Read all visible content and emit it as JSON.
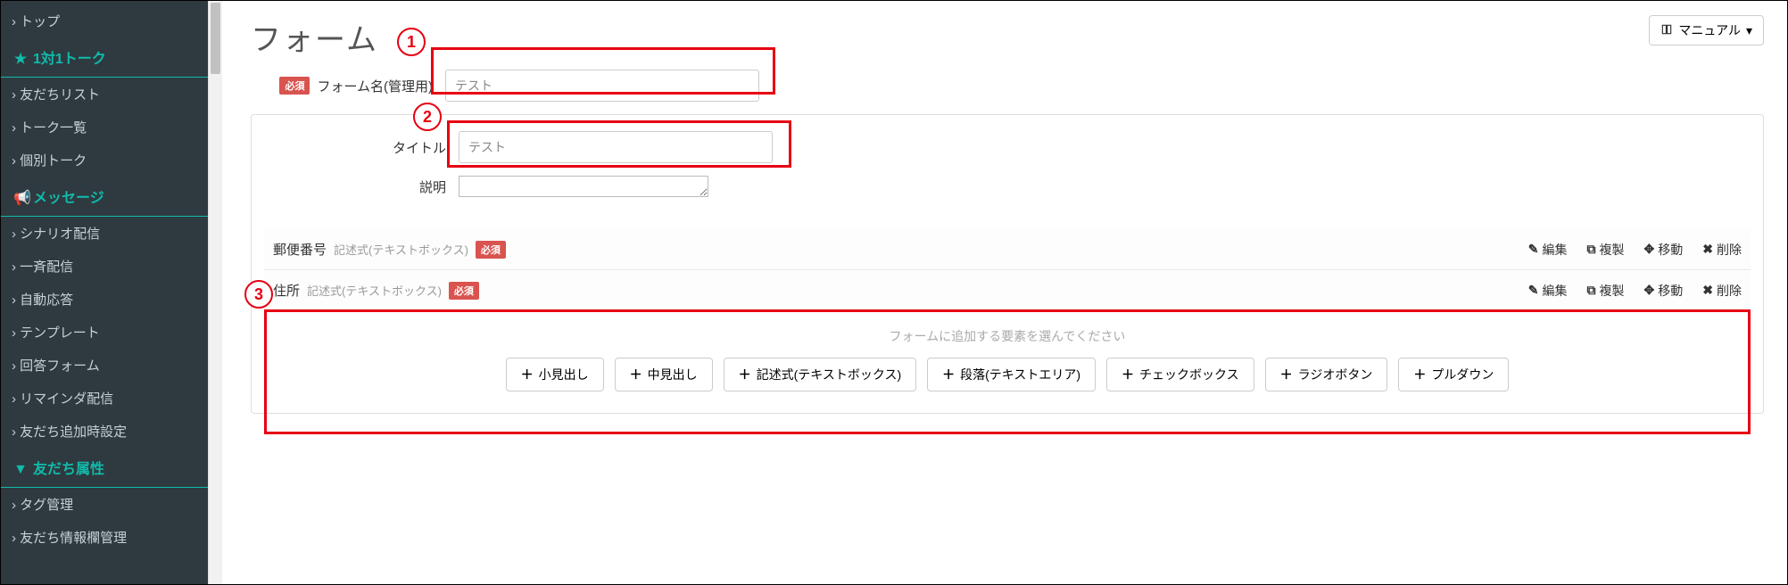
{
  "sidebar": {
    "items_top": [
      {
        "label": "トップ"
      }
    ],
    "group1": {
      "icon": "star",
      "label": "1対1トーク",
      "items": [
        {
          "label": "友だちリスト"
        },
        {
          "label": "トーク一覧"
        },
        {
          "label": "個別トーク"
        }
      ]
    },
    "group2": {
      "icon": "megaphone",
      "label": "メッセージ",
      "items": [
        {
          "label": "シナリオ配信"
        },
        {
          "label": "一斉配信"
        },
        {
          "label": "自動応答"
        },
        {
          "label": "テンプレート"
        },
        {
          "label": "回答フォーム"
        },
        {
          "label": "リマインダ配信"
        },
        {
          "label": "友だち追加時設定"
        }
      ]
    },
    "group3": {
      "icon": "filter",
      "label": "友だち属性",
      "items": [
        {
          "label": "タグ管理"
        },
        {
          "label": "友だち情報欄管理"
        }
      ]
    }
  },
  "header": {
    "title": "フォーム",
    "manual_label": "マニュアル"
  },
  "form": {
    "required_badge": "必須",
    "name_label": "フォーム名(管理用)",
    "name_value": "テスト",
    "title_label": "タイトル",
    "title_value": "テスト",
    "desc_label": "説明"
  },
  "fields": [
    {
      "title": "郵便番号",
      "sub": "記述式(テキストボックス)"
    },
    {
      "title": "住所",
      "sub": "記述式(テキストボックス)"
    }
  ],
  "field_actions": {
    "edit": "編集",
    "copy": "複製",
    "move": "移動",
    "delete": "削除"
  },
  "add": {
    "prompt": "フォームに追加する要素を選んでください",
    "buttons": [
      "小見出し",
      "中見出し",
      "記述式(テキストボックス)",
      "段落(テキストエリア)",
      "チェックボックス",
      "ラジオボタン",
      "プルダウン"
    ]
  },
  "annotations": {
    "n1": "1",
    "n2": "2",
    "n3": "3"
  }
}
